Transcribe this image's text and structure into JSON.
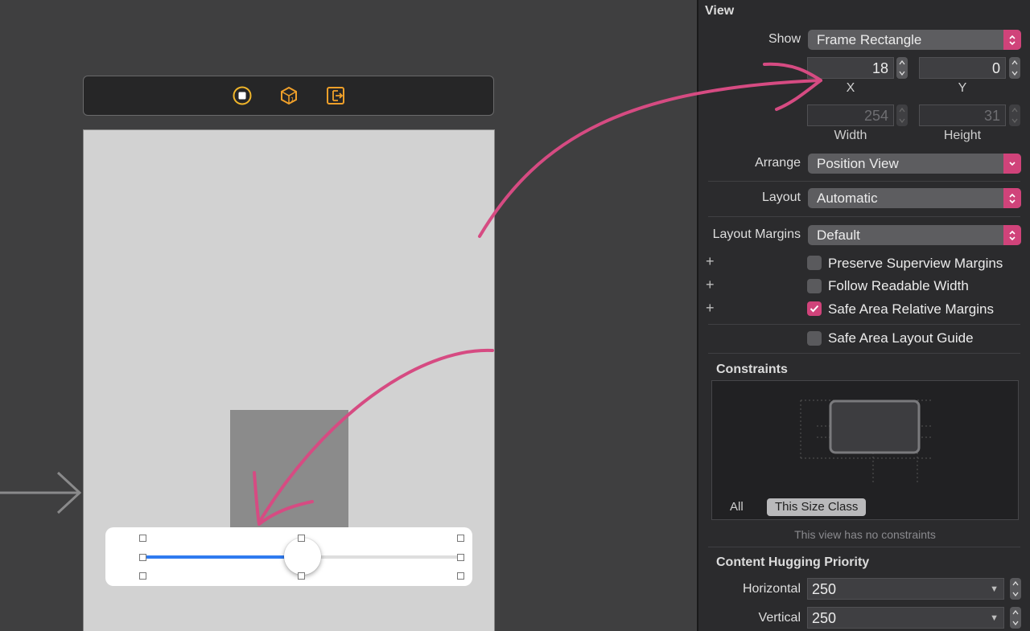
{
  "inspector": {
    "view_title": "View",
    "show": {
      "label": "Show",
      "value": "Frame Rectangle"
    },
    "frame": {
      "x": {
        "value": "18",
        "label": "X"
      },
      "y": {
        "value": "0",
        "label": "Y"
      },
      "width": {
        "value": "254",
        "label": "Width"
      },
      "height": {
        "value": "31",
        "label": "Height"
      }
    },
    "arrange": {
      "label": "Arrange",
      "value": "Position View"
    },
    "layout": {
      "label": "Layout",
      "value": "Automatic"
    },
    "layout_margins": {
      "label": "Layout Margins",
      "value": "Default"
    },
    "checkboxes": [
      {
        "label": "Preserve Superview Margins",
        "checked": false
      },
      {
        "label": "Follow Readable Width",
        "checked": false
      },
      {
        "label": "Safe Area Relative Margins",
        "checked": true
      },
      {
        "label": "Safe Area Layout Guide",
        "checked": false
      }
    ],
    "constraints": {
      "title": "Constraints",
      "tab_all": "All",
      "tab_size_class": "This Size Class",
      "note": "This view has no constraints"
    },
    "hugging": {
      "title": "Content Hugging Priority",
      "horizontal": {
        "label": "Horizontal",
        "value": "250"
      },
      "vertical": {
        "label": "Vertical",
        "value": "250"
      }
    }
  },
  "colors": {
    "accent": "#d0437a",
    "annotation": "#d64b82",
    "slider_tint": "#2f7bf0",
    "canvas_bg": "#3f3f40"
  },
  "canvas": {
    "dock_icons": [
      "view-controller-icon",
      "first-responder-icon",
      "exit-icon"
    ],
    "slider": {
      "value_fraction": 0.5
    }
  }
}
